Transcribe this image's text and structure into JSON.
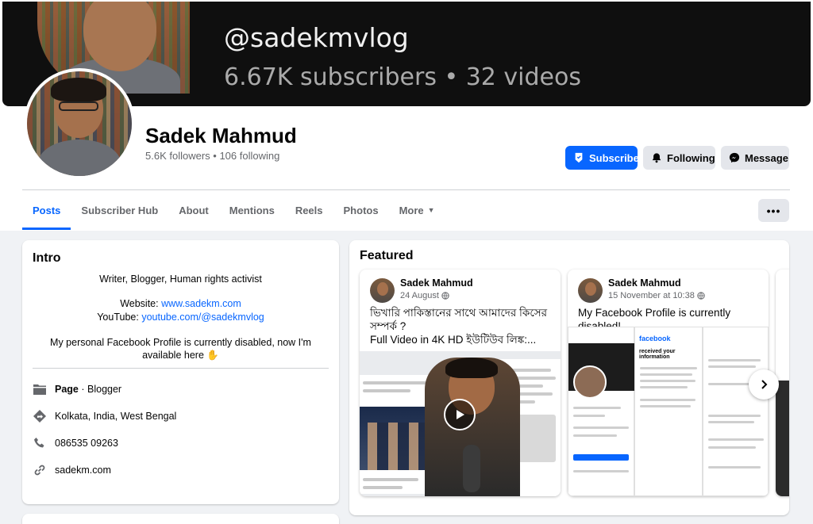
{
  "cover": {
    "handle": "@sadekmvlog",
    "stats": "6.67K subscribers • 32 videos"
  },
  "profile": {
    "name": "Sadek Mahmud",
    "followers": "5.6K followers",
    "following": "106 following",
    "separator": " • "
  },
  "actions": {
    "subscribe": "Subscribe",
    "following": "Following",
    "message": "Message",
    "more": "•••"
  },
  "tabs": [
    {
      "label": "Posts"
    },
    {
      "label": "Subscriber Hub"
    },
    {
      "label": "About"
    },
    {
      "label": "Mentions"
    },
    {
      "label": "Reels"
    },
    {
      "label": "Photos"
    },
    {
      "label": "More"
    }
  ],
  "intro": {
    "title": "Intro",
    "bio": "Writer, Blogger, Human rights activist",
    "website_label": "Website: ",
    "website_link": "www.sadekm.com",
    "youtube_label": "YouTube: ",
    "youtube_link": "youtube.com/@sadekmvlog",
    "note": "My personal Facebook Profile is currently disabled, now I'm available here ✋",
    "page_label": "Page",
    "page_sep": " · ",
    "page_category": "Blogger",
    "location": "Kolkata, India, West Bengal",
    "phone": "086535 09263",
    "site": "sadekm.com"
  },
  "featured": {
    "title": "Featured",
    "posts": [
      {
        "author": "Sadek Mahmud",
        "date": "24 August",
        "text": "ভিখারি পাকিস্তানের সাথে আমাদের কিসের সম্পর্ক ?",
        "text2": "Full Video in 4K HD ইউটিউব লিঙ্ক:..."
      },
      {
        "author": "Sadek Mahmud",
        "date": "15 November at 10:38",
        "text": "My Facebook Profile is currently disabled!"
      }
    ],
    "thumb2_brand": "facebook",
    "thumb2_heading": "received your information"
  },
  "colors": {
    "accent": "#0866ff",
    "background": "#f0f2f5",
    "secondary_text": "#65676b",
    "button_gray": "#e4e6eb"
  },
  "icons": [
    "subscribe-shield-icon",
    "bell-icon",
    "messenger-icon",
    "page-flag-icon",
    "location-icon",
    "phone-icon",
    "link-icon",
    "globe-icon",
    "play-icon",
    "chevron-right-icon",
    "caret-down-icon"
  ]
}
